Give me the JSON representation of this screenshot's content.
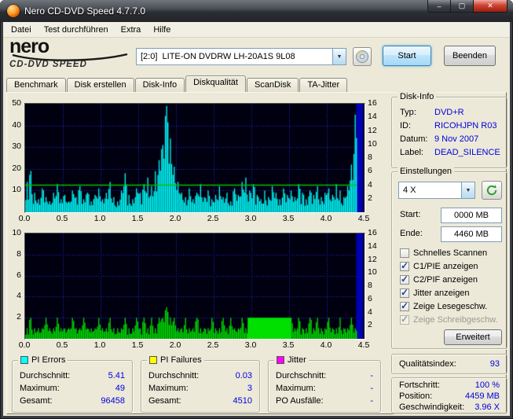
{
  "window": {
    "title": "Nero CD-DVD Speed 4.7.7.0"
  },
  "menubar": {
    "items": [
      "Datei",
      "Test durchführen",
      "Extra",
      "Hilfe"
    ]
  },
  "logo": {
    "name": "nero",
    "subtitle": "CD-DVD SPEED"
  },
  "toolbar": {
    "drive_selector": "[2:0]  LITE-ON DVDRW LH-20A1S 9L08",
    "start_label": "Start",
    "quit_label": "Beenden"
  },
  "tabs": {
    "items": [
      "Benchmark",
      "Disk erstellen",
      "Disk-Info",
      "Diskqualität",
      "ScanDisk",
      "TA-Jitter"
    ],
    "active": "Diskqualität"
  },
  "disk_info": {
    "title": "Disk-Info",
    "rows": [
      {
        "label": "Typ:",
        "value": "DVD+R"
      },
      {
        "label": "ID:",
        "value": "RICOHJPN R03"
      },
      {
        "label": "Datum:",
        "value": "9 Nov 2007"
      },
      {
        "label": "Label:",
        "value": "DEAD_SILENCE"
      }
    ]
  },
  "settings": {
    "title": "Einstellungen",
    "speed_value": "4 X",
    "start_label": "Start:",
    "start_value": "0000 MB",
    "end_label": "Ende:",
    "end_value": "4460 MB",
    "checkboxes": [
      {
        "label": "Schnelles Scannen",
        "checked": false,
        "enabled": true
      },
      {
        "label": "C1/PIE anzeigen",
        "checked": true,
        "enabled": true
      },
      {
        "label": "C2/PIF anzeigen",
        "checked": true,
        "enabled": true
      },
      {
        "label": "Jitter anzeigen",
        "checked": true,
        "enabled": true
      },
      {
        "label": "Zeige Lesegeschw.",
        "checked": true,
        "enabled": true
      },
      {
        "label": "Zeige Schreibgeschw.",
        "checked": true,
        "enabled": false
      }
    ],
    "advanced_label": "Erweitert"
  },
  "quality": {
    "label": "Qualitätsindex:",
    "value": "93"
  },
  "progress": {
    "rows": [
      {
        "label": "Fortschritt:",
        "value": "100 %"
      },
      {
        "label": "Position:",
        "value": "4459 MB"
      },
      {
        "label": "Geschwindigkeit:",
        "value": "3.96 X"
      }
    ]
  },
  "legends": [
    {
      "title": "PI Errors",
      "swatch": "#00ffff",
      "rows": [
        {
          "label": "Durchschnitt:",
          "value": "5.41"
        },
        {
          "label": "Maximum:",
          "value": "49"
        },
        {
          "label": "Gesamt:",
          "value": "96458"
        }
      ]
    },
    {
      "title": "PI Failures",
      "swatch": "#ffff00",
      "rows": [
        {
          "label": "Durchschnitt:",
          "value": "0.03"
        },
        {
          "label": "Maximum:",
          "value": "3"
        },
        {
          "label": "Gesamt:",
          "value": "4510"
        }
      ]
    },
    {
      "title": "Jitter",
      "swatch": "#ff00ff",
      "rows": [
        {
          "label": "Durchschnitt:",
          "value": "-"
        },
        {
          "label": "Maximum:",
          "value": "-"
        },
        {
          "label": "PO Ausfälle:",
          "value": "-"
        }
      ]
    }
  ],
  "chart_data": [
    {
      "type": "area",
      "series": "PI Errors",
      "x_start": 0,
      "x_step": 0.05,
      "xlim": [
        0,
        4.5
      ],
      "xticks": [
        0,
        0.5,
        1,
        1.5,
        2,
        2.5,
        3,
        3.5,
        4,
        4.5
      ],
      "ylim_left": [
        0,
        50
      ],
      "yticks_left": [
        10,
        20,
        30,
        40,
        50
      ],
      "ylim_right": [
        0,
        16
      ],
      "yticks_right": [
        2,
        4,
        6,
        8,
        10,
        12,
        14,
        16
      ],
      "values": [
        14,
        19,
        9,
        6,
        11,
        7,
        5,
        9,
        13,
        6,
        8,
        5,
        10,
        7,
        12,
        6,
        9,
        5,
        8,
        11,
        6,
        9,
        14,
        7,
        5,
        10,
        18,
        8,
        6,
        11,
        9,
        13,
        16,
        12,
        19,
        24,
        31,
        49,
        34,
        21,
        14,
        9,
        7,
        11,
        6,
        9,
        13,
        7,
        10,
        6,
        8,
        12,
        7,
        9,
        5,
        11,
        8,
        14,
        16,
        10,
        13,
        8,
        6,
        10,
        7,
        12,
        9,
        6,
        11,
        8,
        10,
        7,
        13,
        9,
        6,
        10,
        8,
        12,
        7,
        9,
        11,
        8,
        13,
        10,
        7,
        12,
        22,
        45
      ],
      "read_speed_line": {
        "right_value": 4,
        "x_end": 4.39
      },
      "leadout": {
        "x0": 4.39,
        "x1": 4.48
      },
      "colors": {
        "bg": "#000010",
        "grid": "#2a2ada",
        "data": "#00ffff",
        "speed": "#00c000",
        "leadout": "#0000b4"
      }
    },
    {
      "type": "area",
      "series": "PI Failures",
      "x_start": 0,
      "x_step": 0.05,
      "xlim": [
        0,
        4.5
      ],
      "xticks": [
        0,
        0.5,
        1,
        1.5,
        2,
        2.5,
        3,
        3.5,
        4,
        4.5
      ],
      "ylim_left": [
        0,
        10
      ],
      "yticks_left": [
        2,
        4,
        6,
        8,
        10
      ],
      "ylim_right": [
        0,
        16
      ],
      "yticks_right": [
        2,
        4,
        6,
        8,
        10,
        12,
        14,
        16
      ],
      "values": [
        1,
        2,
        1,
        1,
        1,
        2,
        1,
        1,
        2,
        1,
        1,
        1,
        2,
        1,
        1,
        2,
        1,
        1,
        1,
        2,
        1,
        1,
        2,
        1,
        1,
        1,
        2,
        1,
        1,
        2,
        1,
        2,
        1,
        2,
        1,
        2,
        2,
        3,
        2,
        2,
        1,
        1,
        2,
        1,
        1,
        2,
        1,
        1,
        1,
        2,
        1,
        1,
        2,
        1,
        2,
        1,
        1,
        2,
        1,
        2,
        2,
        2,
        2,
        2,
        2,
        2,
        2,
        2,
        2,
        2,
        2,
        1,
        2,
        1,
        1,
        2,
        1,
        2,
        1,
        1,
        2,
        1,
        1,
        2,
        1,
        1,
        2,
        1
      ],
      "solid_block": {
        "x0": 2.95,
        "x1": 3.52,
        "value": 2
      },
      "leadout": {
        "x0": 4.39,
        "x1": 4.48
      },
      "colors": {
        "bg": "#000010",
        "grid": "#2a2ada",
        "data": "#00e000",
        "leadout": "#0000b4"
      }
    }
  ]
}
